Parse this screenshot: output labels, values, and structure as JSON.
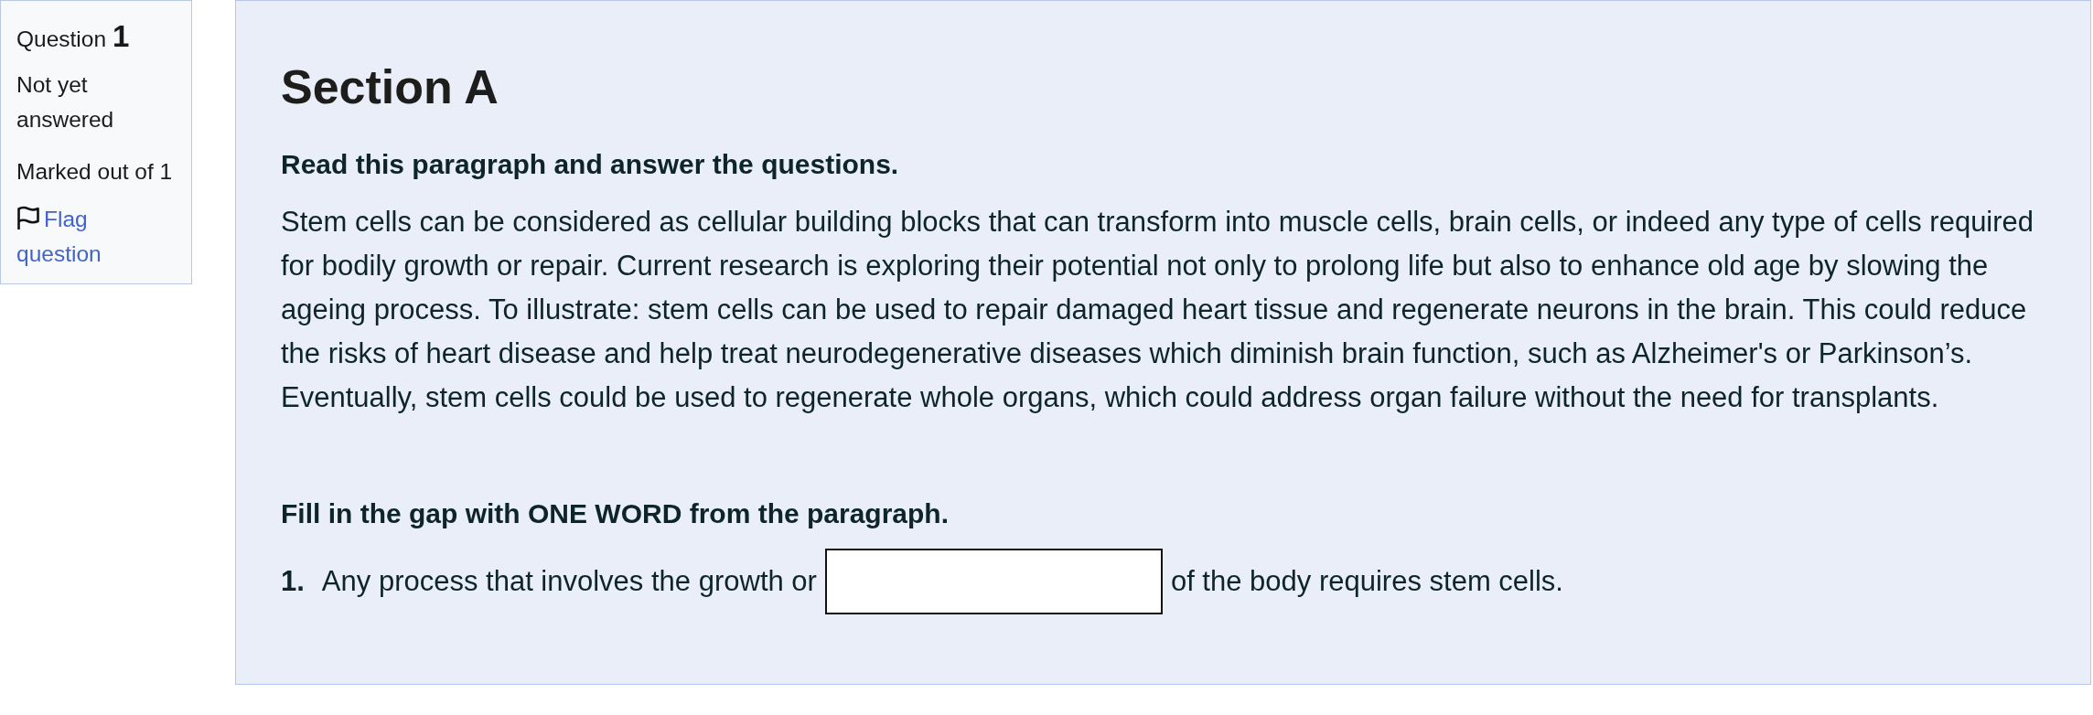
{
  "question_info": {
    "label": "Question",
    "number": "1",
    "status": "Not yet answered",
    "marks": "Marked out of 1",
    "flag_link": "Flag question"
  },
  "content": {
    "heading": "Section A",
    "instruction": "Read this paragraph and answer the questions.",
    "paragraph": "Stem cells can be considered as cellular building blocks that can transform into muscle cells, brain cells, or indeed any type of cells required for bodily growth or repair. Current research is exploring their potential not only to prolong life but also to enhance old age by slowing the ageing process. To illustrate: stem cells can be used to repair damaged heart tissue and regenerate neurons in the brain. This could reduce the risks of heart disease and help treat neurodegenerative diseases which diminish brain function, such as Alzheimer's or Parkinson’s. Eventually, stem cells could be used to regenerate whole organs, which could address organ failure without the need for transplants.",
    "gap_instruction": "Fill in the gap with ONE WORD from the paragraph.",
    "items": [
      {
        "number": "1.",
        "before": "Any process that involves the growth or",
        "after": "of the body requires stem cells."
      }
    ]
  }
}
